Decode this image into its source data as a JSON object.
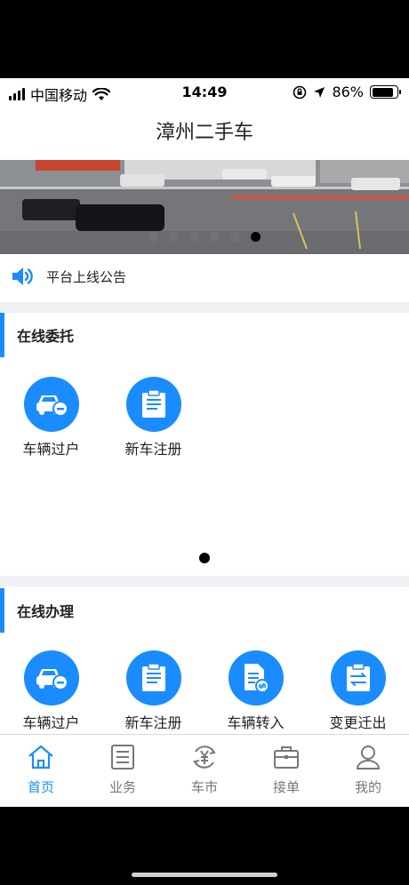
{
  "status_bar": {
    "carrier": "中国移动",
    "time": "14:49",
    "battery_percent": "86%",
    "battery_level": 0.86
  },
  "nav": {
    "title": "漳州二手车"
  },
  "banner": {
    "slide_count": 6,
    "active_index": 5
  },
  "notice": {
    "text": "平台上线公告"
  },
  "sections": {
    "online_entrust": {
      "title": "在线委托",
      "items": [
        {
          "label": "车辆过户",
          "icon": "car-transfer-icon"
        },
        {
          "label": "新车注册",
          "icon": "clipboard-icon"
        }
      ]
    },
    "online_process": {
      "title": "在线办理",
      "items": [
        {
          "label": "车辆过户",
          "icon": "car-transfer-icon"
        },
        {
          "label": "新车注册",
          "icon": "clipboard-icon"
        },
        {
          "label": "车辆转入",
          "icon": "document-transfer-icon"
        },
        {
          "label": "变更迁出",
          "icon": "swap-clipboard-icon"
        }
      ]
    }
  },
  "tabbar": {
    "items": [
      {
        "label": "首页",
        "icon": "home-icon",
        "active": true
      },
      {
        "label": "业务",
        "icon": "list-icon",
        "active": false
      },
      {
        "label": "车市",
        "icon": "yuan-exchange-icon",
        "active": false
      },
      {
        "label": "接单",
        "icon": "briefcase-icon",
        "active": false
      },
      {
        "label": "我的",
        "icon": "user-icon",
        "active": false
      }
    ]
  },
  "colors": {
    "accent": "#1a8cff",
    "divider": "#eef0f4",
    "inactive": "#777777"
  }
}
